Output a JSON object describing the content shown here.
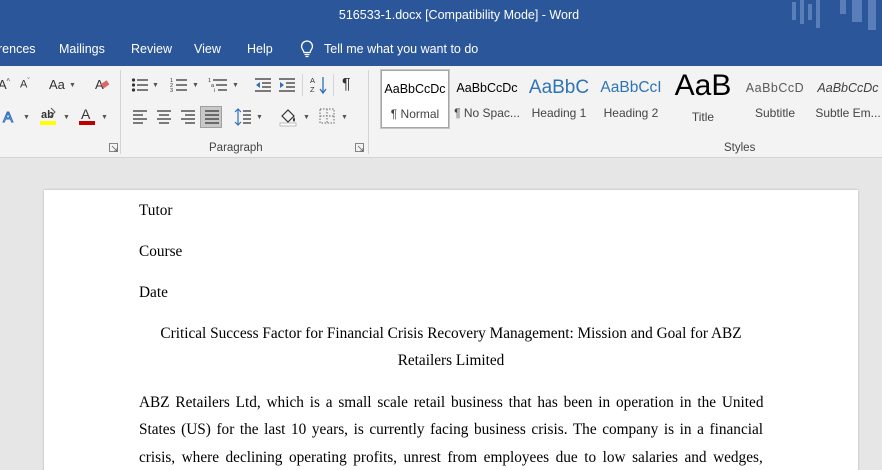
{
  "window": {
    "title": "516533-1.docx [Compatibility Mode]  -  Word"
  },
  "menu": {
    "tabs": [
      "rences",
      "Mailings",
      "Review",
      "View",
      "Help"
    ],
    "tell_me": "Tell me what you want to do"
  },
  "ribbon": {
    "font_group": {
      "case_label": "Aa"
    },
    "paragraph_label": "Paragraph",
    "styles_label": "Styles",
    "styles": [
      {
        "preview": "AaBbCcDc",
        "name": "¶ Normal"
      },
      {
        "preview": "AaBbCcDc",
        "name": "¶ No Spac..."
      },
      {
        "preview": "AaBbC",
        "name": "Heading 1"
      },
      {
        "preview": "AaBbCcI",
        "name": "Heading 2"
      },
      {
        "preview": "AaB",
        "name": "Title"
      },
      {
        "preview": "AaBbCcD",
        "name": "Subtitle"
      },
      {
        "preview": "AaBbCcDc",
        "name": "Subtle Em..."
      }
    ],
    "colors": {
      "highlight": "#ffff00",
      "font_color": "#c00000",
      "accent": "#2b579a"
    }
  },
  "document": {
    "header_lines": [
      "Tutor",
      "Course",
      "Date"
    ],
    "title_line1": "Critical Success Factor for Financial Crisis Recovery Management: Mission and Goal for ABZ",
    "title_line2": "Retailers Limited",
    "body_lines": [
      "ABZ Retailers Ltd, which is a small scale retail business that has been in operation in the United",
      "States (US) for the last 10 years, is currently facing business crisis. The company is in a financial",
      "crisis, where declining operating profits, unrest from employees due to low salaries and wedges,"
    ]
  }
}
